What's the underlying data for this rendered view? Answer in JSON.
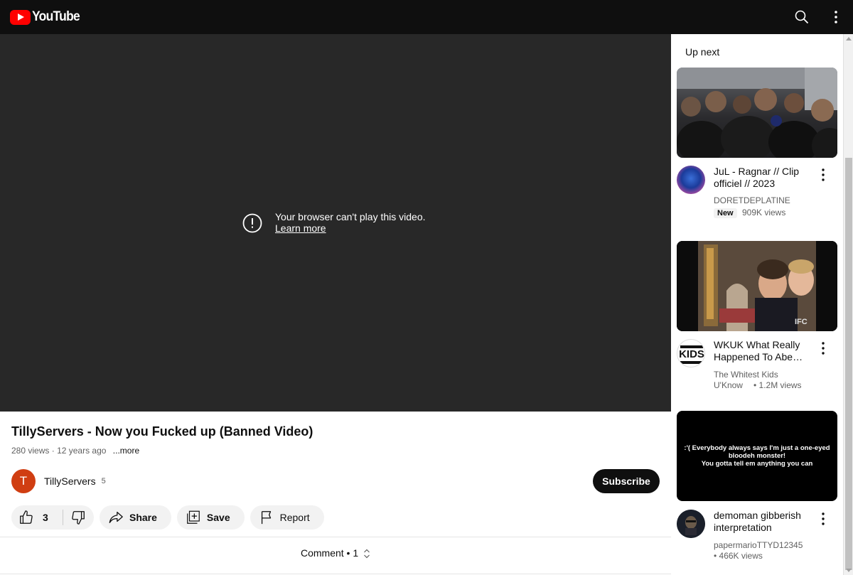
{
  "header": {
    "logo_text": "YouTube"
  },
  "player": {
    "error_message": "Your browser can't play this video.",
    "learn_more": "Learn more"
  },
  "video": {
    "title": "TillyServers - Now you Fucked up (Banned Video)",
    "views": "280 views",
    "separator": "·",
    "age": "12 years ago",
    "more": "...more"
  },
  "channel": {
    "avatar_letter": "T",
    "name": "TillyServers",
    "subscribers": "5",
    "subscribe_label": "Subscribe"
  },
  "actions": {
    "like_count": "3",
    "share_label": "Share",
    "save_label": "Save",
    "report_label": "Report"
  },
  "comments": {
    "label": "Comment",
    "bullet": "•",
    "count": "1"
  },
  "sidebar": {
    "heading": "Up next",
    "items": [
      {
        "title": "JuL - Ragnar // Clip officiel // 2023",
        "channel": "DORETDEPLATINE",
        "badge": "New",
        "views": "909K views"
      },
      {
        "title": "WKUK What Really Happened To Abe…",
        "channel": "The Whitest Kids U'Know",
        "views": "• 1.2M views"
      },
      {
        "title": "demoman gibberish interpretation",
        "channel": "papermarioTTYD12345",
        "views": "• 466K views",
        "thumb_caption_line1": ":'( Everybody always says I'm just a one-eyed bloodeh monster!",
        "thumb_caption_line2": "You gotta tell em anything you can"
      }
    ]
  },
  "colors": {
    "topbar": "#0f0f0f",
    "player_bg": "#282828",
    "brand_red": "#ff0000",
    "subscribe_bg": "#0f0f0f",
    "pill_bg": "#f2f2f2"
  }
}
